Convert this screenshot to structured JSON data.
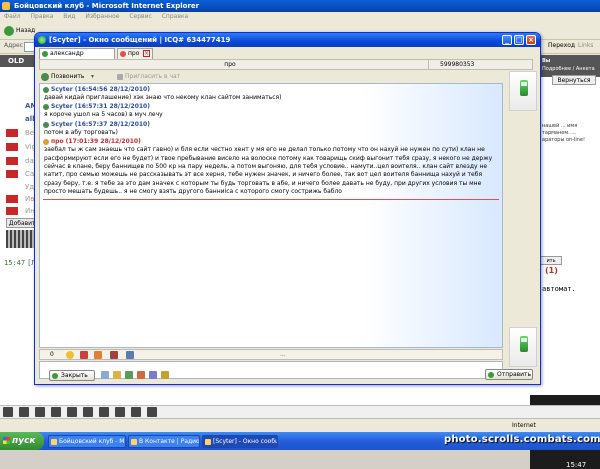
{
  "ie": {
    "title": "Бойцовский клуб - Microsoft Internet Explorer",
    "menu": [
      "Файл",
      "Правка",
      "Вид",
      "Избранное",
      "Сервис",
      "Справка"
    ],
    "back_label": "Назад",
    "address_label": "Адрес",
    "go_label": "Переход",
    "links_label": "Links",
    "status_done": "",
    "status_zone": "Internet"
  },
  "page": {
    "logo": "OLD",
    "nicks": [
      "AMEG",
      "allekz",
      "Besch",
      "Vigen",
      "dashe",
      "Catar",
      "Удо",
      "Иван",
      "Интер"
    ],
    "add_button": "Добавить",
    "time": "15:47",
    "time_nick": "[Лес",
    "right_header_a": "Вы",
    "right_header_b": "Подробнее / Анкета",
    "back_button": "Вернуться",
    "right_note": "нашей ... имя тарманем. ... араторы on-line!",
    "right_count": "(1)",
    "right_button": "ить",
    "right_avtomat": "автомат.",
    "clock": "15:47"
  },
  "chat": {
    "title": "[Scyter] - Окно сообщений | ICQ# 634477419",
    "tabs": [
      {
        "label": "александр неваренных"
      },
      {
        "label": "про"
      }
    ],
    "contact_name": "про",
    "contact_uin": "599980353",
    "call_label": "Позвонить",
    "invite_label": "Пригласить в чат",
    "messages": [
      {
        "header": "Scyter (16:54:56 28/12/2010)",
        "direction": "out",
        "text": "давай кидай приглашение) хэк знаю что некому клан сайтом заниматься)"
      },
      {
        "header": "Scyter (16:57:31 28/12/2010)",
        "direction": "out",
        "text": "я короче ушол на 5 часов) в муч лечу"
      },
      {
        "header": "Scyter (16:57:37 28/12/2010)",
        "direction": "out",
        "text": "потом в абу торговать)"
      },
      {
        "header": "про (17:01:39 28/12/2010)",
        "direction": "in",
        "text": "заебал ты ж сам знаешь что сайт гавно) и бля если честно хент у мя его не делал только потому что он нахуй не нужен по сути) клан не расформируют если его не будет) и твое пребывание висело на волоске потому как товарищь скиф выгонит тебя сразу, я некого не держу сейчас в клане, беру баннищев по 500 кр на пару недель, а потом выгоняю, для тебя условие.. намути..цел воителя.. клан сайт влезду не катит, про семью можешь не рассказывать эт все херня, тебе нужен значек, и ничего более, так вот цел воителя баннища нахуй и тебя сразу беру, т.е. я тебе за это дам значек с которым ты будь торговать в абе, и ничего более давать не буду, при других условия ты мне просто мешать будешь.. я не смогу взять другого банниica с которого смогу сострижь бабло"
      }
    ],
    "input_count": "0",
    "input_ellipsis": "...",
    "close_button": "Закрыть",
    "send_button": "Отправить"
  },
  "taskbar": {
    "start": "пуск",
    "tasks": [
      "Бойцовский клуб - M...",
      "В Контакте | Радио ...",
      "[Scyter] - Окно сообщ..."
    ]
  },
  "watermark": "photo.scrolls.combats.com",
  "colors": {
    "xp_blue": "#0a48d8",
    "out_msg_header": "#2b4a9a",
    "in_msg_header": "#c82828"
  }
}
